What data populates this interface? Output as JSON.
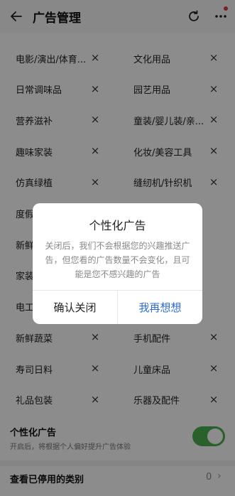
{
  "header": {
    "back_icon": "arrow-left-icon",
    "title": "广告管理",
    "refresh_icon": "refresh-icon",
    "more_icon": "more-vertical-icon"
  },
  "categories": [
    [
      "电影/演出/体育...",
      "文化用品"
    ],
    [
      "日常调味品",
      "园艺用品"
    ],
    [
      "营养滋补",
      "童装/婴儿装/亲..."
    ],
    [
      "趣味家装",
      "化妆/美容工具"
    ],
    [
      "仿真绿植",
      "缝纫机/针织机"
    ],
    [
      "度假",
      ""
    ],
    [
      "新鲜",
      ""
    ],
    [
      "家装",
      ""
    ],
    [
      "电工",
      ""
    ],
    [
      "新鲜蔬菜",
      "手机配件"
    ],
    [
      "寿司日料",
      "儿童床品"
    ],
    [
      "礼品包装",
      "乐器及配件"
    ]
  ],
  "remove_symbol": "×",
  "settings": {
    "personalized_title": "个性化广告",
    "personalized_desc": "开启后，将根据个人偏好提升广告体验",
    "toggle_on": true,
    "disabled_title": "查看已停用的类别",
    "disabled_count": "0",
    "chevron": "›"
  },
  "dialog": {
    "title": "个性化广告",
    "body": "关闭后，我们不会根据您的兴趣推送广告，但您看的广告数量不会变化，且可能是您不感兴趣的广告",
    "confirm_label": "确认关闭",
    "cancel_label": "我再想想"
  },
  "colors": {
    "accent_blue": "#2f6bd8",
    "toggle_green": "#4caf50",
    "badge_red": "#e53935"
  }
}
